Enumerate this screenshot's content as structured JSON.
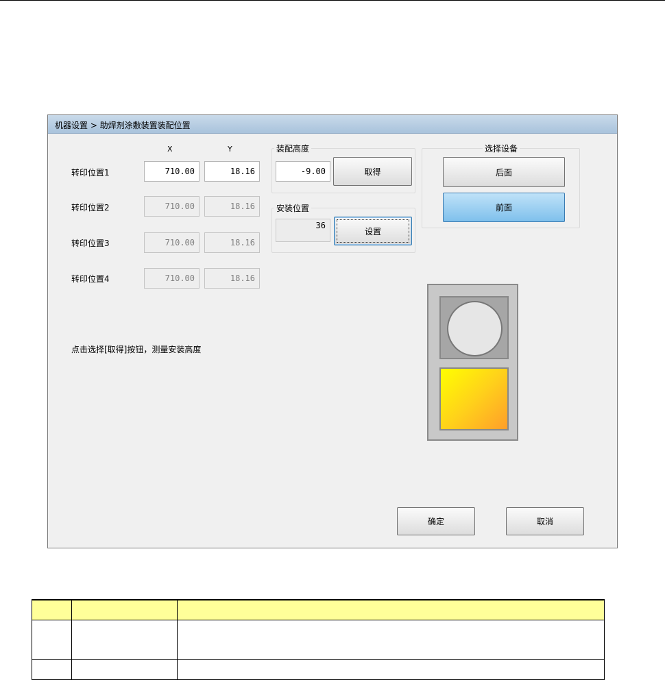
{
  "window": {
    "breadcrumb": "机器设置 > 助焊剂涂敷装置装配位置"
  },
  "columns": {
    "x": "X",
    "y": "Y"
  },
  "positions": [
    {
      "label": "转印位置1",
      "x": "710.00",
      "y": "18.16",
      "enabled": true
    },
    {
      "label": "转印位置2",
      "x": "710.00",
      "y": "18.16",
      "enabled": false
    },
    {
      "label": "转印位置3",
      "x": "710.00",
      "y": "18.16",
      "enabled": false
    },
    {
      "label": "转印位置4",
      "x": "710.00",
      "y": "18.16",
      "enabled": false
    }
  ],
  "mount_height": {
    "title": "装配高度",
    "value": "-9.00",
    "button": "取得"
  },
  "install_position": {
    "title": "安装位置",
    "value": "36",
    "button": "设置"
  },
  "select_device": {
    "title": "选择设备",
    "rear": "后面",
    "front": "前面",
    "selected": "front"
  },
  "hint": "点击选择[取得]按钮，测量安装高度",
  "actions": {
    "ok": "确定",
    "cancel": "取消"
  },
  "colors": {
    "title_bar": "#b7cde3",
    "selected_button": "#9fd3f4",
    "diagram_gradient_start": "#ffff00",
    "diagram_gradient_end": "#ff9e2a"
  }
}
